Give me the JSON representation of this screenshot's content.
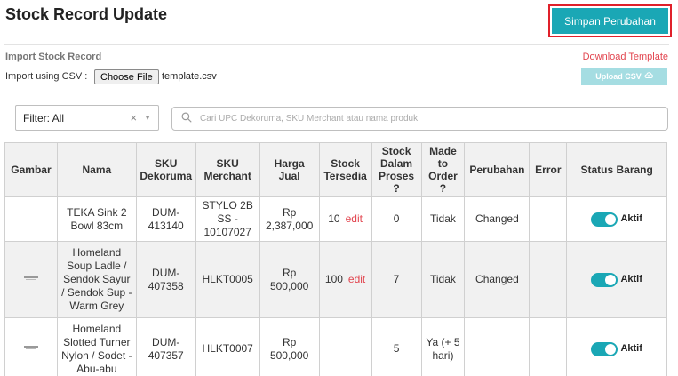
{
  "header": {
    "title": "Stock Record Update",
    "save_label": "Simpan Perubahan"
  },
  "import": {
    "title": "Import Stock Record",
    "download_label": "Download Template",
    "csv_label": "Import using CSV :",
    "choose_label": "Choose File",
    "file_name": "template.csv",
    "upload_label": "Upload CSV"
  },
  "filter": {
    "value": "Filter: All",
    "clear_glyph": "×",
    "chevron_glyph": "▼"
  },
  "search": {
    "placeholder": "Cari UPC Dekoruma, SKU Merchant atau nama produk"
  },
  "table": {
    "headers": [
      "Gambar",
      "Nama",
      "SKU Dekoruma",
      "SKU Merchant",
      "Harga Jual",
      "Stock Tersedia",
      "Stock Dalam Proses ?",
      "Made to Order ?",
      "Perubahan",
      "Error",
      "Status Barang"
    ],
    "edit_label": "edit",
    "rows": [
      {
        "nama": "TEKA Sink 2 Bowl 83cm",
        "sku_dekoruma": "DUM-413140",
        "sku_merchant": "STYLO 2B SS - 10107027",
        "harga": "Rp 2,387,000",
        "stock": "10",
        "proses": "0",
        "made_to_order": "Tidak",
        "perubahan": "Changed",
        "error": "",
        "status": "Aktif"
      },
      {
        "nama": "Homeland Soup Ladle / Sendok Sayur / Sendok Sup - Warm Grey",
        "sku_dekoruma": "DUM-407358",
        "sku_merchant": "HLKT0005",
        "harga": "Rp 500,000",
        "stock": "100",
        "proses": "7",
        "made_to_order": "Tidak",
        "perubahan": "Changed",
        "error": "",
        "status": "Aktif"
      },
      {
        "nama": "Homeland Slotted Turner Nylon / Sodet - Abu-abu",
        "sku_dekoruma": "DUM-407357",
        "sku_merchant": "HLKT0007",
        "harga": "Rp 500,000",
        "stock": "",
        "proses": "5",
        "made_to_order": "Ya (+ 5 hari)",
        "perubahan": "",
        "error": "",
        "status": "Aktif"
      }
    ]
  },
  "colors": {
    "accent": "#1aa7b5",
    "accent_disabled": "#a5dde2",
    "link_red": "#e2454f",
    "highlight_border": "#e0202a"
  }
}
